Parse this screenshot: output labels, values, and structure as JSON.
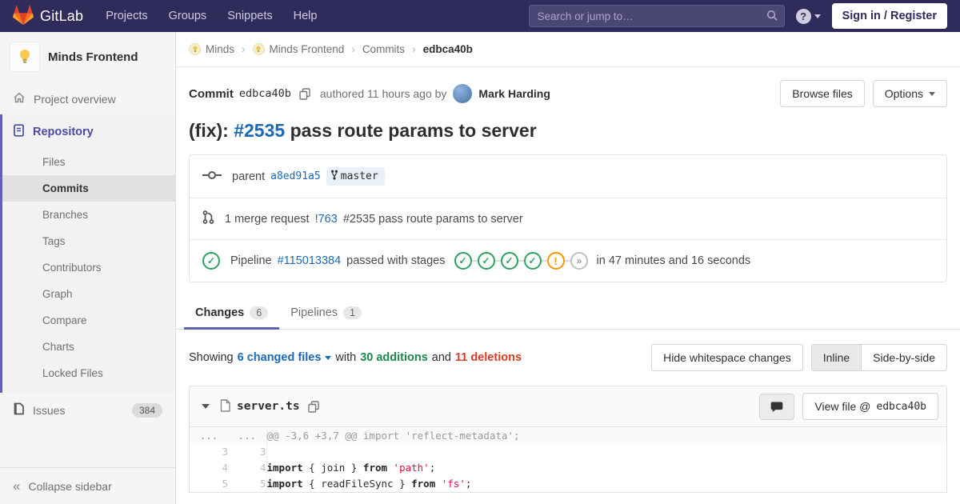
{
  "navbar": {
    "brand": "GitLab",
    "menu": {
      "projects": "Projects",
      "groups": "Groups",
      "snippets": "Snippets",
      "help": "Help"
    },
    "search_placeholder": "Search or jump to…",
    "sign_in": "Sign in / Register"
  },
  "sidebar": {
    "project_name": "Minds Frontend",
    "overview": "Project overview",
    "repository": "Repository",
    "repo_items": [
      "Files",
      "Commits",
      "Branches",
      "Tags",
      "Contributors",
      "Graph",
      "Compare",
      "Charts",
      "Locked Files"
    ],
    "issues": "Issues",
    "issues_count": "384",
    "collapse": "Collapse sidebar"
  },
  "breadcrumb": {
    "group": "Minds",
    "project": "Minds Frontend",
    "section": "Commits",
    "current": "edbca40b",
    "separator": "›"
  },
  "commit": {
    "label": "Commit",
    "sha": "edbca40b",
    "authored": "authored 11 hours ago by",
    "author": "Mark Harding",
    "browse_files": "Browse files",
    "options": "Options",
    "title_prefix": "(fix): ",
    "title_issue": "#2535",
    "title_suffix": " pass route params to server",
    "parent_label": "parent",
    "parent_sha": "a8ed91a5",
    "branch": "master",
    "mr_count_text": "1 merge request",
    "mr_ref": "!763",
    "mr_title": "#2535 pass route params to server",
    "pipeline_label": "Pipeline",
    "pipeline_id": "#115013384",
    "pipeline_status_text": "passed with stages",
    "pipeline_stages": [
      "success",
      "success",
      "success",
      "success",
      "warning",
      "skipped"
    ],
    "pipeline_duration": "in 47 minutes and 16 seconds"
  },
  "tabs": {
    "changes": "Changes",
    "changes_count": "6",
    "pipelines": "Pipelines",
    "pipelines_count": "1"
  },
  "diff_controls": {
    "showing": "Showing",
    "changed_files": "6 changed files",
    "with": "with",
    "additions": "30 additions",
    "and": "and",
    "deletions": "11 deletions",
    "hide_whitespace": "Hide whitespace changes",
    "inline": "Inline",
    "side_by_side": "Side-by-side"
  },
  "file_diff": {
    "filename": "server.ts",
    "view_file_label": "View file @",
    "view_file_sha": "edbca40b",
    "hunk_ellipsis": "...",
    "hunk_header": "@@ -3,6 +3,7 @@ import 'reflect-metadata';",
    "lines": [
      {
        "old": "3",
        "new": "3",
        "kw1": "",
        "mid": "",
        "kw2": "",
        "str": "",
        "end": ""
      },
      {
        "old": "4",
        "new": "4",
        "kw1": "import",
        "mid": " { join } ",
        "kw2": "from",
        "str": " 'path'",
        "end": ";"
      },
      {
        "old": "5",
        "new": "5",
        "kw1": "import",
        "mid": " { readFileSync } ",
        "kw2": "from",
        "str": " 'fs'",
        "end": ";"
      }
    ]
  },
  "colors": {
    "navbar_bg": "#2f2c5c",
    "sidebar_accent": "#6262b0",
    "link_blue": "#1b69b6",
    "success_green": "#2da160",
    "warning_orange": "#fc9403",
    "additions_green": "#1e874b",
    "deletions_red": "#db3b21",
    "string_red": "#d14"
  }
}
